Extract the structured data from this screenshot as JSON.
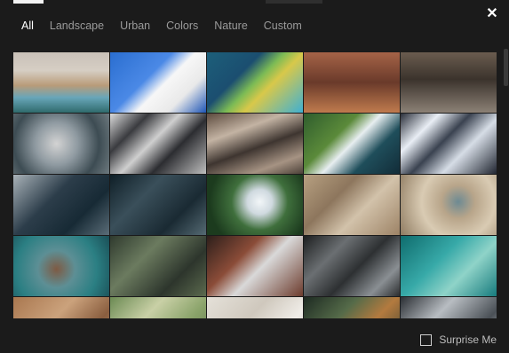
{
  "header": {
    "close_icon": "close-icon",
    "close_glyph": "✕"
  },
  "tabs": [
    {
      "label": "All",
      "active": true
    },
    {
      "label": "Landscape",
      "active": false
    },
    {
      "label": "Urban",
      "active": false
    },
    {
      "label": "Colors",
      "active": false
    },
    {
      "label": "Nature",
      "active": false
    },
    {
      "label": "Custom",
      "active": false
    }
  ],
  "thumbnails": [
    {
      "id": "coastal-beach-island"
    },
    {
      "id": "white-building-blue-sky"
    },
    {
      "id": "material-geometric-blue-yellow"
    },
    {
      "id": "red-rock-monolith"
    },
    {
      "id": "dark-mountain-snow"
    },
    {
      "id": "aerial-roads-city"
    },
    {
      "id": "aerial-ridges-gray"
    },
    {
      "id": "aerial-brown-ridges"
    },
    {
      "id": "green-coast-waves"
    },
    {
      "id": "snowy-mountains-dark"
    },
    {
      "id": "coast-dark-blue"
    },
    {
      "id": "dark-coastline"
    },
    {
      "id": "snow-volcano-peak"
    },
    {
      "id": "desert-pit-aerial"
    },
    {
      "id": "open-pit-mine"
    },
    {
      "id": "venice-lagoon"
    },
    {
      "id": "forbidden-city-aerial"
    },
    {
      "id": "brown-coast-cliffs"
    },
    {
      "id": "gray-city-grid"
    },
    {
      "id": "turquoise-reef"
    },
    {
      "id": "tan-desert-aerial"
    },
    {
      "id": "green-farmland-aerial"
    },
    {
      "id": "pale-sand-aerial"
    },
    {
      "id": "green-dark-terrain"
    },
    {
      "id": "urban-gray-aerial"
    }
  ],
  "footer": {
    "surprise_label": "Surprise Me",
    "surprise_checked": false
  }
}
